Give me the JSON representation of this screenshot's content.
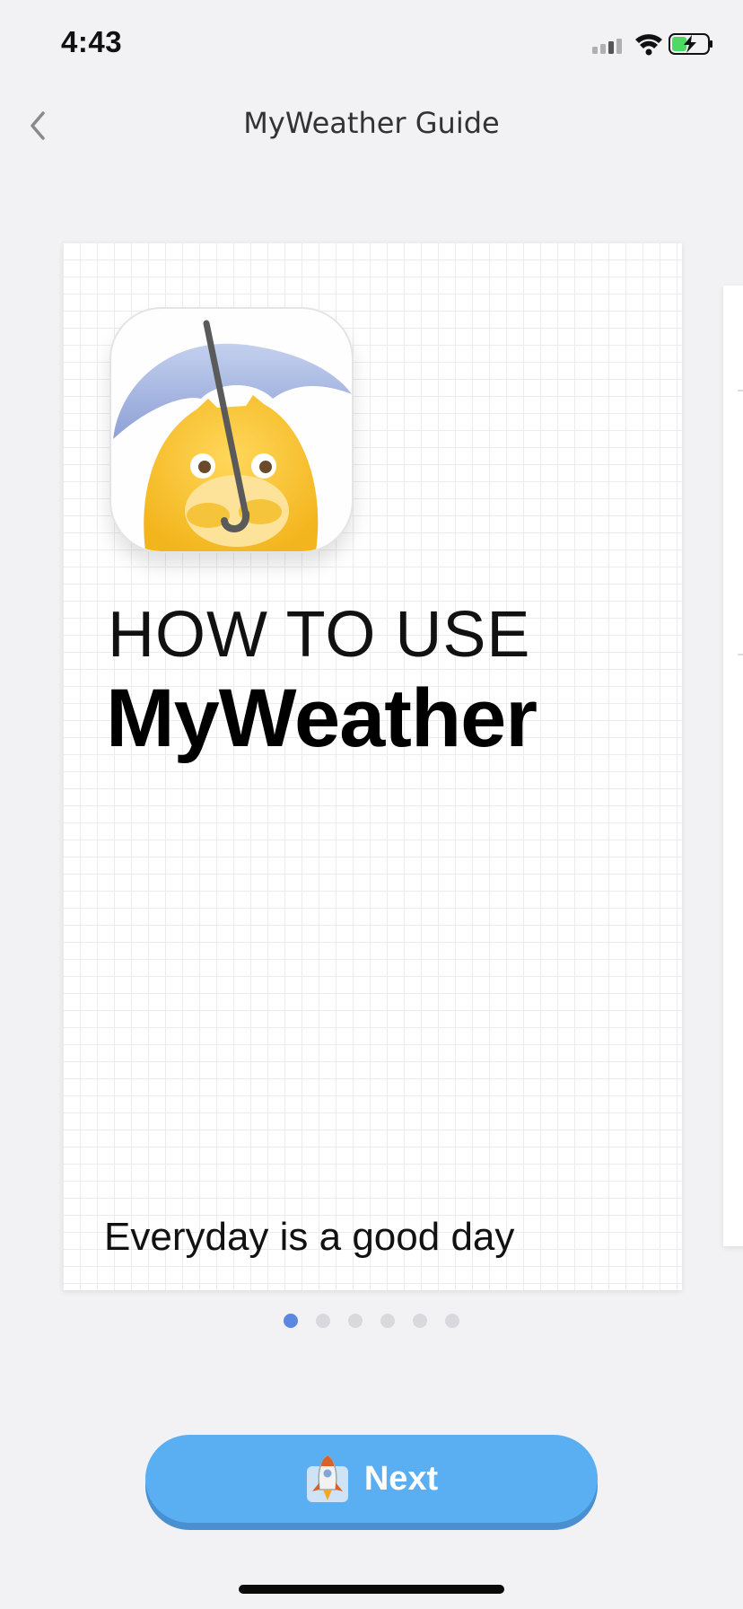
{
  "status_bar": {
    "time": "4:43",
    "icons": [
      "cellular-signal-icon",
      "wifi-icon",
      "battery-charging-icon"
    ],
    "battery_color": "#4cd964"
  },
  "nav": {
    "title": "MyWeather Guide",
    "back_icon": "chevron-left-icon"
  },
  "card": {
    "heading": "HOW TO USE",
    "brand": "MyWeather",
    "tagline": "Everyday is a good day",
    "icon": "app-mascot-umbrella-icon"
  },
  "pagination": {
    "total": 6,
    "current": 1,
    "active_color": "#5b87e0",
    "inactive_color": "#d9d9dd"
  },
  "next_button": {
    "label": "Next",
    "icon": "rocket-mascot-icon",
    "color": "#5aaef2"
  }
}
